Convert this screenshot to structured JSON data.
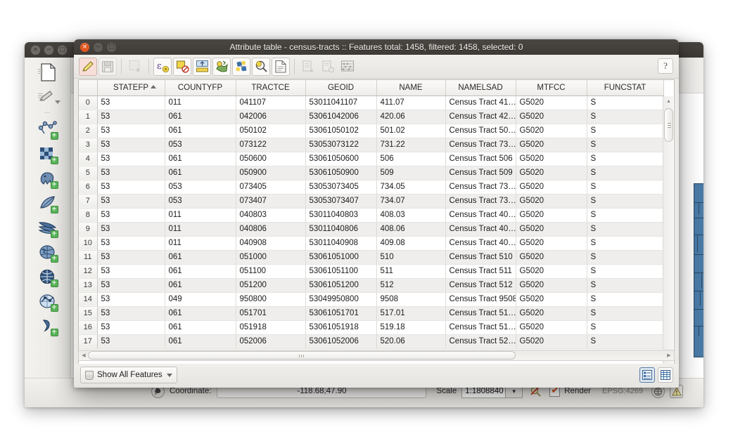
{
  "main_window": {
    "name": "qgis-main-window",
    "window_buttons": [
      "close",
      "minimize",
      "maximize"
    ],
    "left_toolbar": {
      "items": [
        {
          "name": "new-project-icon",
          "label": "New Project"
        },
        {
          "name": "open-project-icon",
          "label": "Open Project"
        },
        {
          "name": "pencil-edit-icon",
          "label": "Toggle Editing"
        },
        {
          "name": "add-vector-layer-icon",
          "label": "Add Vector Layer"
        },
        {
          "name": "add-raster-layer-icon",
          "label": "Add Raster Layer"
        },
        {
          "name": "add-postgis-layer-icon",
          "label": "Add PostGIS Layers"
        },
        {
          "name": "add-spatialite-layer-icon",
          "label": "Add SpatiaLite Layer"
        },
        {
          "name": "add-mssql-layer-icon",
          "label": "Add MSSQL Spatial Layer"
        },
        {
          "name": "add-wms-layer-icon",
          "label": "Add WMS/WMTS Layer"
        },
        {
          "name": "add-wcs-layer-icon",
          "label": "Add WCS Layer"
        },
        {
          "name": "add-wfs-layer-icon",
          "label": "Add WFS Layer"
        },
        {
          "name": "add-delimited-text-layer-icon",
          "label": "Add Delimited Text Layer"
        }
      ],
      "overflow_label": "»"
    },
    "help_button_label": "?",
    "overflow_button_label": "»",
    "status_bar": {
      "coordinate_label": "Coordinate:",
      "coordinate_value": "-118.68,47.90",
      "scale_label": "Scale",
      "scale_value": "1:1808840",
      "render_label": "Render",
      "render_checked": true,
      "epsg_label": "EPSG:4269",
      "icons": [
        "messages-icon",
        "magnifier-stop-icon",
        "globe-crs-icon",
        "warning-icon"
      ]
    }
  },
  "attribute_table": {
    "title": "Attribute table - census-tracts :: Features total: 1458, filtered: 1458, selected: 0",
    "layer_name": "census-tracts",
    "features_total": 1458,
    "features_filtered": 1458,
    "features_selected": 0,
    "window_buttons": [
      "close",
      "minimize",
      "maximize"
    ],
    "toolbar": {
      "items": [
        {
          "name": "toggle-editing-icon",
          "label": "Toggle editing mode",
          "state": "active"
        },
        {
          "name": "save-edits-icon",
          "label": "Save edits",
          "state": "disabled"
        },
        {
          "name": "deselect-all-icon",
          "label": "Unselect all",
          "state": "disabled"
        },
        {
          "name": "select-by-expression-icon",
          "label": "Select features using an expression"
        },
        {
          "name": "move-selection-to-top-icon",
          "label": "Move selection to top"
        },
        {
          "name": "invert-selection-icon",
          "label": "Invert selection"
        },
        {
          "name": "pan-to-selection-icon",
          "label": "Pan map to the selected rows"
        },
        {
          "name": "zoom-to-selection-icon",
          "label": "Zoom map to the selected rows"
        },
        {
          "name": "new-field-icon",
          "label": "New field"
        },
        {
          "name": "copy-selected-icon",
          "label": "Copy selected rows to clipboard",
          "state": "disabled"
        },
        {
          "name": "paste-features-icon",
          "label": "Paste features from clipboard",
          "state": "disabled"
        },
        {
          "name": "open-field-calculator-icon",
          "label": "Open field calculator"
        }
      ],
      "help_label": "?"
    },
    "columns": [
      {
        "key": "STATEFP",
        "label": "STATEFP",
        "sorted": true,
        "sort_dir": "asc"
      },
      {
        "key": "COUNTYFP",
        "label": "COUNTYFP"
      },
      {
        "key": "TRACTCE",
        "label": "TRACTCE"
      },
      {
        "key": "GEOID",
        "label": "GEOID"
      },
      {
        "key": "NAME",
        "label": "NAME"
      },
      {
        "key": "NAMELSAD",
        "label": "NAMELSAD"
      },
      {
        "key": "MTFCC",
        "label": "MTFCC"
      },
      {
        "key": "FUNCSTAT",
        "label": "FUNCSTAT"
      }
    ],
    "rows": [
      {
        "id": "0",
        "STATEFP": "53",
        "COUNTYFP": "011",
        "TRACTCE": "041107",
        "GEOID": "53011041107",
        "NAME": "411.07",
        "NAMELSAD": "Census Tract 41…",
        "MTFCC": "G5020",
        "FUNCSTAT": "S"
      },
      {
        "id": "1",
        "STATEFP": "53",
        "COUNTYFP": "061",
        "TRACTCE": "042006",
        "GEOID": "53061042006",
        "NAME": "420.06",
        "NAMELSAD": "Census Tract 42…",
        "MTFCC": "G5020",
        "FUNCSTAT": "S"
      },
      {
        "id": "2",
        "STATEFP": "53",
        "COUNTYFP": "061",
        "TRACTCE": "050102",
        "GEOID": "53061050102",
        "NAME": "501.02",
        "NAMELSAD": "Census Tract 50…",
        "MTFCC": "G5020",
        "FUNCSTAT": "S"
      },
      {
        "id": "3",
        "STATEFP": "53",
        "COUNTYFP": "053",
        "TRACTCE": "073122",
        "GEOID": "53053073122",
        "NAME": "731.22",
        "NAMELSAD": "Census Tract 73…",
        "MTFCC": "G5020",
        "FUNCSTAT": "S"
      },
      {
        "id": "4",
        "STATEFP": "53",
        "COUNTYFP": "061",
        "TRACTCE": "050600",
        "GEOID": "53061050600",
        "NAME": "506",
        "NAMELSAD": "Census Tract 506",
        "MTFCC": "G5020",
        "FUNCSTAT": "S"
      },
      {
        "id": "5",
        "STATEFP": "53",
        "COUNTYFP": "061",
        "TRACTCE": "050900",
        "GEOID": "53061050900",
        "NAME": "509",
        "NAMELSAD": "Census Tract 509",
        "MTFCC": "G5020",
        "FUNCSTAT": "S"
      },
      {
        "id": "6",
        "STATEFP": "53",
        "COUNTYFP": "053",
        "TRACTCE": "073405",
        "GEOID": "53053073405",
        "NAME": "734.05",
        "NAMELSAD": "Census Tract 73…",
        "MTFCC": "G5020",
        "FUNCSTAT": "S"
      },
      {
        "id": "7",
        "STATEFP": "53",
        "COUNTYFP": "053",
        "TRACTCE": "073407",
        "GEOID": "53053073407",
        "NAME": "734.07",
        "NAMELSAD": "Census Tract 73…",
        "MTFCC": "G5020",
        "FUNCSTAT": "S"
      },
      {
        "id": "8",
        "STATEFP": "53",
        "COUNTYFP": "011",
        "TRACTCE": "040803",
        "GEOID": "53011040803",
        "NAME": "408.03",
        "NAMELSAD": "Census Tract 40…",
        "MTFCC": "G5020",
        "FUNCSTAT": "S"
      },
      {
        "id": "9",
        "STATEFP": "53",
        "COUNTYFP": "011",
        "TRACTCE": "040806",
        "GEOID": "53011040806",
        "NAME": "408.06",
        "NAMELSAD": "Census Tract 40…",
        "MTFCC": "G5020",
        "FUNCSTAT": "S"
      },
      {
        "id": "10",
        "STATEFP": "53",
        "COUNTYFP": "011",
        "TRACTCE": "040908",
        "GEOID": "53011040908",
        "NAME": "409.08",
        "NAMELSAD": "Census Tract 40…",
        "MTFCC": "G5020",
        "FUNCSTAT": "S"
      },
      {
        "id": "11",
        "STATEFP": "53",
        "COUNTYFP": "061",
        "TRACTCE": "051000",
        "GEOID": "53061051000",
        "NAME": "510",
        "NAMELSAD": "Census Tract 510",
        "MTFCC": "G5020",
        "FUNCSTAT": "S"
      },
      {
        "id": "12",
        "STATEFP": "53",
        "COUNTYFP": "061",
        "TRACTCE": "051100",
        "GEOID": "53061051100",
        "NAME": "511",
        "NAMELSAD": "Census Tract 511",
        "MTFCC": "G5020",
        "FUNCSTAT": "S"
      },
      {
        "id": "13",
        "STATEFP": "53",
        "COUNTYFP": "061",
        "TRACTCE": "051200",
        "GEOID": "53061051200",
        "NAME": "512",
        "NAMELSAD": "Census Tract 512",
        "MTFCC": "G5020",
        "FUNCSTAT": "S"
      },
      {
        "id": "14",
        "STATEFP": "53",
        "COUNTYFP": "049",
        "TRACTCE": "950800",
        "GEOID": "53049950800",
        "NAME": "9508",
        "NAMELSAD": "Census Tract 9508",
        "MTFCC": "G5020",
        "FUNCSTAT": "S"
      },
      {
        "id": "15",
        "STATEFP": "53",
        "COUNTYFP": "061",
        "TRACTCE": "051701",
        "GEOID": "53061051701",
        "NAME": "517.01",
        "NAMELSAD": "Census Tract 51…",
        "MTFCC": "G5020",
        "FUNCSTAT": "S"
      },
      {
        "id": "16",
        "STATEFP": "53",
        "COUNTYFP": "061",
        "TRACTCE": "051918",
        "GEOID": "53061051918",
        "NAME": "519.18",
        "NAMELSAD": "Census Tract 51…",
        "MTFCC": "G5020",
        "FUNCSTAT": "S"
      },
      {
        "id": "17",
        "STATEFP": "53",
        "COUNTYFP": "061",
        "TRACTCE": "052006",
        "GEOID": "53061052006",
        "NAME": "520.06",
        "NAMELSAD": "Census Tract 52…",
        "MTFCC": "G5020",
        "FUNCSTAT": "S"
      }
    ],
    "bottom_bar": {
      "filter_label": "Show All Features",
      "view_form_icon": "form-view-icon",
      "view_table_icon": "table-view-icon",
      "active_view": "table"
    }
  },
  "colors": {
    "titlebar_active": "#4a4743",
    "titlebar_inactive": "#474440",
    "close_button": "#e0561f",
    "accent_blue": "#4a7ba7",
    "render_check": "#e05a1c",
    "selected_view_bg": "#dbe6f2"
  }
}
